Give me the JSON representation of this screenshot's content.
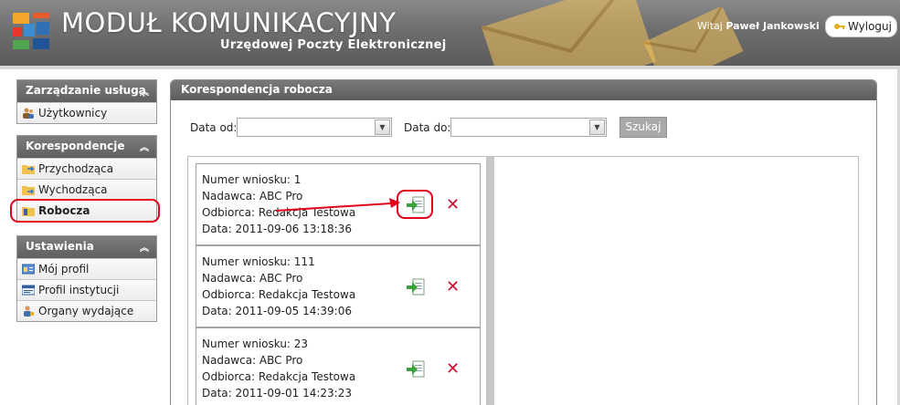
{
  "header": {
    "title": "MODUŁ KOMUNIKACYJNY",
    "subtitle": "Urzędowej Poczty Elektronicznej",
    "welcome_prefix": "Witaj",
    "user_name": "Paweł Jankowski",
    "logout_label": "Wyloguj"
  },
  "sidebar": {
    "sections": [
      {
        "title": "Zarządzanie usługą",
        "items": [
          "Użytkownicy"
        ]
      },
      {
        "title": "Korespondencje",
        "items": [
          "Przychodząca",
          "Wychodząca",
          "Robocza"
        ]
      },
      {
        "title": "Ustawienia",
        "items": [
          "Mój profil",
          "Profil instytucji",
          "Organy wydające"
        ]
      }
    ],
    "active_item": "Robocza"
  },
  "panel": {
    "title": "Korespondencja robocza",
    "filter": {
      "date_from_label": "Data od:",
      "date_from_value": "",
      "date_to_label": "Data do:",
      "date_to_value": "",
      "search_label": "Szukaj"
    },
    "items": [
      {
        "numer": "Numer wniosku: 1",
        "nadawca": "Nadawca: ABC Pro",
        "odbiorca": "Odbiorca: Redakcja Testowa",
        "data": "Data: 2011-09-06 13:18:36"
      },
      {
        "numer": "Numer wniosku: 111",
        "nadawca": "Nadawca: ABC Pro",
        "odbiorca": "Odbiorca: Redakcja Testowa",
        "data": "Data: 2011-09-05 14:39:06"
      },
      {
        "numer": "Numer wniosku: 23",
        "nadawca": "Nadawca: ABC Pro",
        "odbiorca": "Odbiorca: Redakcja Testowa",
        "data": "Data: 2011-09-01 14:23:23"
      }
    ]
  },
  "colors": {
    "header_bg": "#6e6e6e",
    "accent_red": "#e3001b",
    "delete_red": "#c8102e",
    "edit_green": "#3aa33a",
    "search_button": "#a9a9a9"
  },
  "icons": {
    "logo": "logo-squares-icon",
    "logout": "key-icon",
    "users": "users-icon",
    "incoming": "folder-in-icon",
    "outgoing": "folder-out-icon",
    "draft": "folder-draft-icon",
    "profile": "id-card-icon",
    "institution": "institution-card-icon",
    "authorities": "person-icon",
    "edit": "edit-document-icon",
    "delete": "delete-x-icon"
  }
}
